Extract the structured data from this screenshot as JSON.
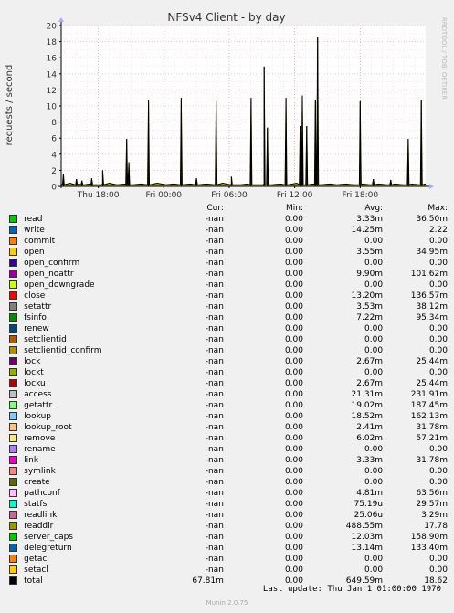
{
  "chart_data": {
    "type": "area",
    "title": "NFSv4 Client - by day",
    "ylabel": "requests / second",
    "watermark": "RRDTOOL / TOBI OETIKER",
    "ylim": [
      0,
      20
    ],
    "yticks": [
      0,
      2,
      4,
      6,
      8,
      10,
      12,
      14,
      16,
      18,
      20
    ],
    "x_range_hours": [
      -33.4,
      0
    ],
    "xticks": [
      {
        "label": "Thu 18:00",
        "h": -30
      },
      {
        "label": "Fri 00:00",
        "h": -24
      },
      {
        "label": "Fri 06:00",
        "h": -18
      },
      {
        "label": "Fri 12:00",
        "h": -12
      },
      {
        "label": "Fri 18:00",
        "h": -6
      }
    ],
    "grid": true,
    "baseline_points": [
      [
        -33.4,
        0.3
      ],
      [
        -32.6,
        0.4
      ],
      [
        -32.1,
        0.2
      ],
      [
        -31.8,
        0.3
      ],
      [
        -31.3,
        0.2
      ],
      [
        -30.8,
        0.3
      ],
      [
        -30.2,
        0.2
      ],
      [
        -29.6,
        0.3
      ],
      [
        -29.0,
        0.4
      ],
      [
        -28.3,
        0.2
      ],
      [
        -27.5,
        0.3
      ],
      [
        -26.8,
        0.2
      ],
      [
        -26.1,
        0.3
      ],
      [
        -25.3,
        0.2
      ],
      [
        -24.6,
        0.4
      ],
      [
        -23.8,
        0.2
      ],
      [
        -23.1,
        0.3
      ],
      [
        -22.3,
        0.2
      ],
      [
        -21.6,
        0.3
      ],
      [
        -20.8,
        0.2
      ],
      [
        -20.1,
        0.3
      ],
      [
        -19.3,
        0.2
      ],
      [
        -18.6,
        0.4
      ],
      [
        -17.8,
        0.3
      ],
      [
        -17.0,
        0.2
      ],
      [
        -16.3,
        0.3
      ],
      [
        -15.5,
        0.2
      ],
      [
        -14.8,
        0.3
      ],
      [
        -14.1,
        0.2
      ],
      [
        -13.3,
        0.3
      ],
      [
        -12.6,
        0.2
      ],
      [
        -11.8,
        0.4
      ],
      [
        -11.1,
        0.2
      ],
      [
        -10.3,
        0.3
      ],
      [
        -9.6,
        0.2
      ],
      [
        -8.8,
        0.3
      ],
      [
        -8.1,
        0.2
      ],
      [
        -7.3,
        0.3
      ],
      [
        -6.6,
        0.2
      ],
      [
        -5.8,
        0.3
      ],
      [
        -5.1,
        0.2
      ],
      [
        -4.3,
        0.3
      ],
      [
        -3.6,
        0.2
      ],
      [
        -2.8,
        0.3
      ],
      [
        -2.1,
        0.2
      ],
      [
        -1.3,
        0.3
      ],
      [
        -0.6,
        0.2
      ],
      [
        0,
        0.3
      ]
    ],
    "spikes": [
      {
        "h": -33.2,
        "v": 1.5
      },
      {
        "h": -32.0,
        "v": 0.9
      },
      {
        "h": -31.5,
        "v": 0.7
      },
      {
        "h": -30.6,
        "v": 1.0
      },
      {
        "h": -29.6,
        "v": 2.0
      },
      {
        "h": -27.4,
        "v": 5.9
      },
      {
        "h": -27.2,
        "v": 3.0
      },
      {
        "h": -25.4,
        "v": 10.7
      },
      {
        "h": -22.4,
        "v": 11.0
      },
      {
        "h": -21.0,
        "v": 1.0
      },
      {
        "h": -19.2,
        "v": 10.6
      },
      {
        "h": -17.8,
        "v": 1.2
      },
      {
        "h": -16.0,
        "v": 11.0
      },
      {
        "h": -14.8,
        "v": 14.9
      },
      {
        "h": -14.5,
        "v": 7.3
      },
      {
        "h": -12.8,
        "v": 11.0
      },
      {
        "h": -11.5,
        "v": 7.5
      },
      {
        "h": -11.3,
        "v": 11.3
      },
      {
        "h": -10.9,
        "v": 7.5
      },
      {
        "h": -10.1,
        "v": 10.8
      },
      {
        "h": -9.9,
        "v": 18.6
      },
      {
        "h": -6.0,
        "v": 10.6
      },
      {
        "h": -4.8,
        "v": 0.9
      },
      {
        "h": -3.2,
        "v": 0.8
      },
      {
        "h": -1.6,
        "v": 5.9
      },
      {
        "h": -0.4,
        "v": 10.8
      }
    ]
  },
  "legend": {
    "headers": {
      "cur": "Cur:",
      "min": "Min:",
      "avg": "Avg:",
      "max": "Max:"
    },
    "rows": [
      {
        "name": "read",
        "color": "#00cc00",
        "cur": "-nan",
        "min": "0.00",
        "avg": "3.33m",
        "max": "36.50m"
      },
      {
        "name": "write",
        "color": "#0066b3",
        "cur": "-nan",
        "min": "0.00",
        "avg": "14.25m",
        "max": "2.22"
      },
      {
        "name": "commit",
        "color": "#ff8000",
        "cur": "-nan",
        "min": "0.00",
        "avg": "0.00",
        "max": "0.00"
      },
      {
        "name": "open",
        "color": "#ffcc00",
        "cur": "-nan",
        "min": "0.00",
        "avg": "3.55m",
        "max": "34.95m"
      },
      {
        "name": "open_confirm",
        "color": "#330099",
        "cur": "-nan",
        "min": "0.00",
        "avg": "0.00",
        "max": "0.00"
      },
      {
        "name": "open_noattr",
        "color": "#990099",
        "cur": "-nan",
        "min": "0.00",
        "avg": "9.90m",
        "max": "101.62m"
      },
      {
        "name": "open_downgrade",
        "color": "#ccff00",
        "cur": "-nan",
        "min": "0.00",
        "avg": "0.00",
        "max": "0.00"
      },
      {
        "name": "close",
        "color": "#ff0000",
        "cur": "-nan",
        "min": "0.00",
        "avg": "13.20m",
        "max": "136.57m"
      },
      {
        "name": "setattr",
        "color": "#808080",
        "cur": "-nan",
        "min": "0.00",
        "avg": "3.53m",
        "max": "38.12m"
      },
      {
        "name": "fsinfo",
        "color": "#008f00",
        "cur": "-nan",
        "min": "0.00",
        "avg": "7.22m",
        "max": "95.34m"
      },
      {
        "name": "renew",
        "color": "#00487d",
        "cur": "-nan",
        "min": "0.00",
        "avg": "0.00",
        "max": "0.00"
      },
      {
        "name": "setclientid",
        "color": "#b35a00",
        "cur": "-nan",
        "min": "0.00",
        "avg": "0.00",
        "max": "0.00"
      },
      {
        "name": "setclientid_confirm",
        "color": "#b38f00",
        "cur": "-nan",
        "min": "0.00",
        "avg": "0.00",
        "max": "0.00"
      },
      {
        "name": "lock",
        "color": "#6b006b",
        "cur": "-nan",
        "min": "0.00",
        "avg": "2.67m",
        "max": "25.44m"
      },
      {
        "name": "lockt",
        "color": "#8fb300",
        "cur": "-nan",
        "min": "0.00",
        "avg": "0.00",
        "max": "0.00"
      },
      {
        "name": "locku",
        "color": "#b30000",
        "cur": "-nan",
        "min": "0.00",
        "avg": "2.67m",
        "max": "25.44m"
      },
      {
        "name": "access",
        "color": "#bebebe",
        "cur": "-nan",
        "min": "0.00",
        "avg": "21.31m",
        "max": "231.91m"
      },
      {
        "name": "getattr",
        "color": "#80ff80",
        "cur": "-nan",
        "min": "0.00",
        "avg": "19.02m",
        "max": "187.45m"
      },
      {
        "name": "lookup",
        "color": "#80c9ff",
        "cur": "-nan",
        "min": "0.00",
        "avg": "18.52m",
        "max": "162.13m"
      },
      {
        "name": "lookup_root",
        "color": "#ffc080",
        "cur": "-nan",
        "min": "0.00",
        "avg": "2.41m",
        "max": "31.78m"
      },
      {
        "name": "remove",
        "color": "#ffe680",
        "cur": "-nan",
        "min": "0.00",
        "avg": "6.02m",
        "max": "57.21m"
      },
      {
        "name": "rename",
        "color": "#aa80ff",
        "cur": "-nan",
        "min": "0.00",
        "avg": "0.00",
        "max": "0.00"
      },
      {
        "name": "link",
        "color": "#ee00cc",
        "cur": "-nan",
        "min": "0.00",
        "avg": "3.33m",
        "max": "31.78m"
      },
      {
        "name": "symlink",
        "color": "#ff8080",
        "cur": "-nan",
        "min": "0.00",
        "avg": "0.00",
        "max": "0.00"
      },
      {
        "name": "create",
        "color": "#666600",
        "cur": "-nan",
        "min": "0.00",
        "avg": "0.00",
        "max": "0.00"
      },
      {
        "name": "pathconf",
        "color": "#ffbfff",
        "cur": "-nan",
        "min": "0.00",
        "avg": "4.81m",
        "max": "63.56m"
      },
      {
        "name": "statfs",
        "color": "#00ffcc",
        "cur": "-nan",
        "min": "0.00",
        "avg": "75.19u",
        "max": "29.57m"
      },
      {
        "name": "readlink",
        "color": "#cc6699",
        "cur": "-nan",
        "min": "0.00",
        "avg": "25.06u",
        "max": "3.29m"
      },
      {
        "name": "readdir",
        "color": "#999900",
        "cur": "-nan",
        "min": "0.00",
        "avg": "488.55m",
        "max": "17.78"
      },
      {
        "name": "server_caps",
        "color": "#00cc00",
        "cur": "-nan",
        "min": "0.00",
        "avg": "12.03m",
        "max": "158.90m"
      },
      {
        "name": "delegreturn",
        "color": "#0066b3",
        "cur": "-nan",
        "min": "0.00",
        "avg": "13.14m",
        "max": "133.40m"
      },
      {
        "name": "getacl",
        "color": "#ff8000",
        "cur": "-nan",
        "min": "0.00",
        "avg": "0.00",
        "max": "0.00"
      },
      {
        "name": "setacl",
        "color": "#ffcc00",
        "cur": "-nan",
        "min": "0.00",
        "avg": "0.00",
        "max": "0.00"
      },
      {
        "name": "total",
        "color": "#000000",
        "cur": "67.81m",
        "min": "0.00",
        "avg": "649.59m",
        "max": "18.62"
      }
    ]
  },
  "footer": {
    "last_update": "Last update: Thu Jan  1 01:00:00 1970",
    "version": "Munin 2.0.75"
  }
}
